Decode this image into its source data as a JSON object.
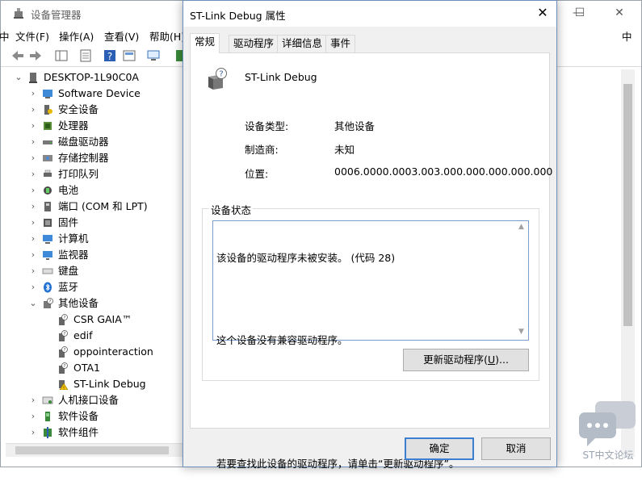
{
  "devmgr": {
    "title": "设备管理器",
    "menu": [
      "文件(F)",
      "操作(A)",
      "查看(V)",
      "帮助(H)"
    ],
    "computer_name": "DESKTOP-1L90C0A",
    "tree": [
      {
        "label": "Software Device"
      },
      {
        "label": "安全设备"
      },
      {
        "label": "处理器"
      },
      {
        "label": "磁盘驱动器"
      },
      {
        "label": "存储控制器"
      },
      {
        "label": "打印队列"
      },
      {
        "label": "电池"
      },
      {
        "label": "端口 (COM 和 LPT)"
      },
      {
        "label": "固件"
      },
      {
        "label": "计算机"
      },
      {
        "label": "监视器"
      },
      {
        "label": "键盘"
      },
      {
        "label": "蓝牙"
      },
      {
        "label": "其他设备"
      },
      {
        "label": "CSR GAIA™"
      },
      {
        "label": "edif"
      },
      {
        "label": "oppointeraction"
      },
      {
        "label": "OTA1"
      },
      {
        "label": "ST-Link Debug"
      },
      {
        "label": "人机接口设备"
      },
      {
        "label": "软件设备"
      },
      {
        "label": "软件组件"
      }
    ]
  },
  "watermark": "ST中文论坛",
  "dialog": {
    "title": "ST-Link Debug 属性",
    "tabs": [
      "常规",
      "驱动程序",
      "详细信息",
      "事件"
    ],
    "device_name": "ST-Link Debug",
    "props": {
      "type_label": "设备类型:",
      "type_value": "其他设备",
      "mfr_label": "制造商:",
      "mfr_value": "未知",
      "loc_label": "位置:",
      "loc_value": "0006.0000.0003.003.000.000.000.000.000"
    },
    "status_legend": "设备状态",
    "status_line1": "该设备的驱动程序未被安装。 (代码 28)",
    "status_line2": "这个设备没有兼容驱动程序。",
    "status_line3": "若要查找此设备的驱动程序，请单击“更新驱动程序”。",
    "update_button_prefix": "更新驱动程序(",
    "update_button_key": "U",
    "update_button_suffix": ")...",
    "ok_label": "确定",
    "cancel_label": "取消"
  }
}
